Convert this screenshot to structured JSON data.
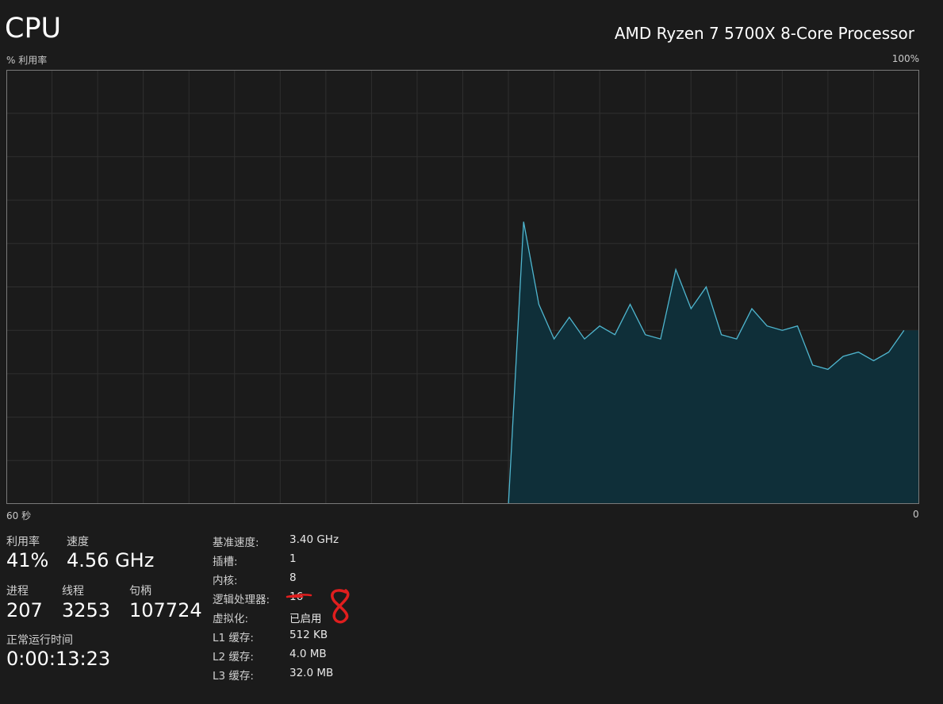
{
  "header": {
    "title": "CPU",
    "processor": "AMD Ryzen 7 5700X 8-Core Processor"
  },
  "graph": {
    "y_label": "% 利用率",
    "y_max_label": "100%",
    "x_start_label": "60 秒",
    "x_end_label": "0",
    "line_color": "#4fb6cf",
    "fill_color": "#0f2f39",
    "grid_color": "#2f2f2f",
    "border_color": "#7a7a7a"
  },
  "chart_data": {
    "type": "area",
    "x": [
      -60,
      -59,
      -58,
      -57,
      -56,
      -55,
      -54,
      -53,
      -52,
      -51,
      -50,
      -49,
      -48,
      -47,
      -46,
      -45,
      -44,
      -43,
      -42,
      -41,
      -40,
      -39,
      -38,
      -37,
      -36,
      -35,
      -34,
      -33,
      -32,
      -31,
      -30,
      -29,
      -28,
      -27,
      -26,
      -25,
      -24,
      -23,
      -22,
      -21,
      -20,
      -19,
      -18,
      -17,
      -16,
      -15,
      -14,
      -13,
      -12,
      -11,
      -10,
      -9,
      -8,
      -7,
      -6,
      -5,
      -4,
      -3,
      -2,
      -1,
      0
    ],
    "values": [
      null,
      null,
      null,
      null,
      null,
      null,
      null,
      null,
      null,
      null,
      null,
      null,
      null,
      null,
      null,
      null,
      null,
      null,
      null,
      null,
      null,
      null,
      null,
      null,
      null,
      null,
      null,
      null,
      null,
      null,
      null,
      null,
      null,
      0,
      65,
      46,
      38,
      43,
      38,
      41,
      39,
      46,
      39,
      38,
      54,
      45,
      50,
      39,
      38,
      45,
      41,
      40,
      41,
      32,
      31,
      34,
      35,
      33,
      35,
      40,
      null
    ],
    "ylim": [
      0,
      100
    ],
    "xlim": [
      -60,
      0
    ],
    "grid": true
  },
  "stats": {
    "utilization": {
      "label": "利用率",
      "value": "41%"
    },
    "speed": {
      "label": "速度",
      "value": "4.56 GHz"
    },
    "processes": {
      "label": "进程",
      "value": "207"
    },
    "threads": {
      "label": "线程",
      "value": "3253"
    },
    "handles": {
      "label": "句柄",
      "value": "107724"
    },
    "uptime": {
      "label": "正常运行时间",
      "value": "0:00:13:23"
    }
  },
  "details": [
    {
      "label": "基准速度:",
      "value": "3.40 GHz"
    },
    {
      "label": "插槽:",
      "value": "1"
    },
    {
      "label": "内核:",
      "value": "8"
    },
    {
      "label": "逻辑处理器:",
      "value": "16",
      "struck": true
    },
    {
      "label": "虚拟化:",
      "value": "已启用"
    },
    {
      "label": "L1 缓存:",
      "value": "512 KB"
    },
    {
      "label": "L2 缓存:",
      "value": "4.0 MB"
    },
    {
      "label": "L3 缓存:",
      "value": "32.0 MB"
    }
  ],
  "annotation": {
    "handwritten": "8",
    "color": "#e01e1e"
  }
}
